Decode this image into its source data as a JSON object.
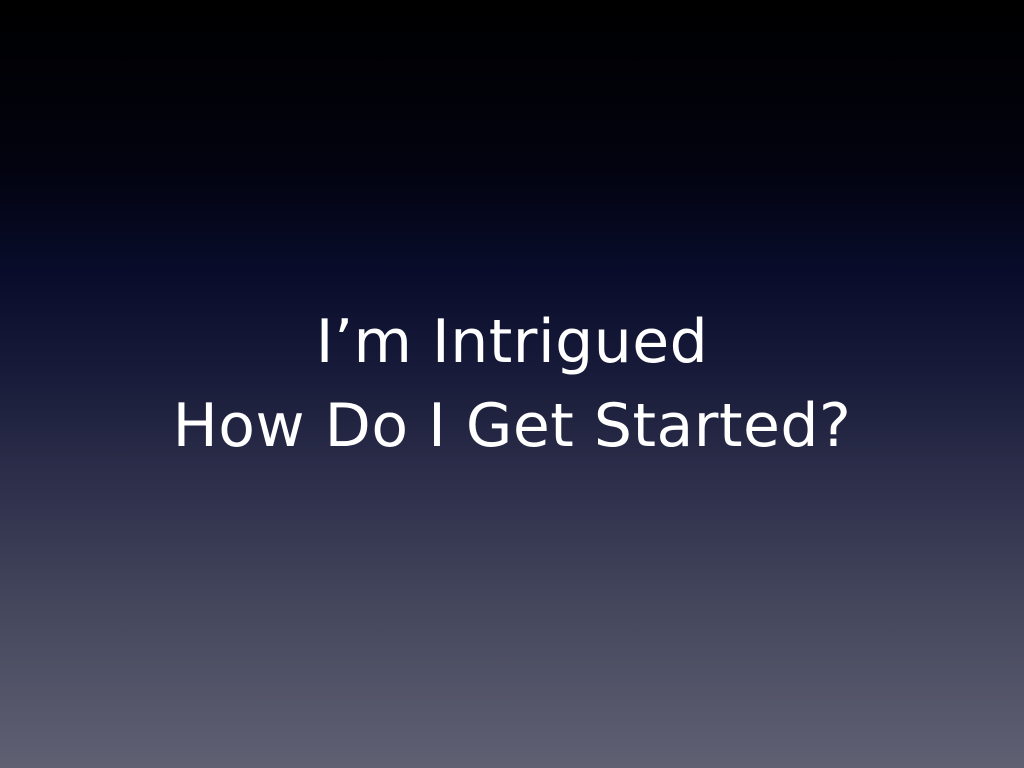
{
  "slide": {
    "title_line_1": "I’m Intrigued",
    "title_line_2": "How Do I Get Started?"
  },
  "colors": {
    "background_top": "#000000",
    "background_mid": "#171a38",
    "background_bottom": "#5f6072",
    "text": "#ffffff"
  }
}
